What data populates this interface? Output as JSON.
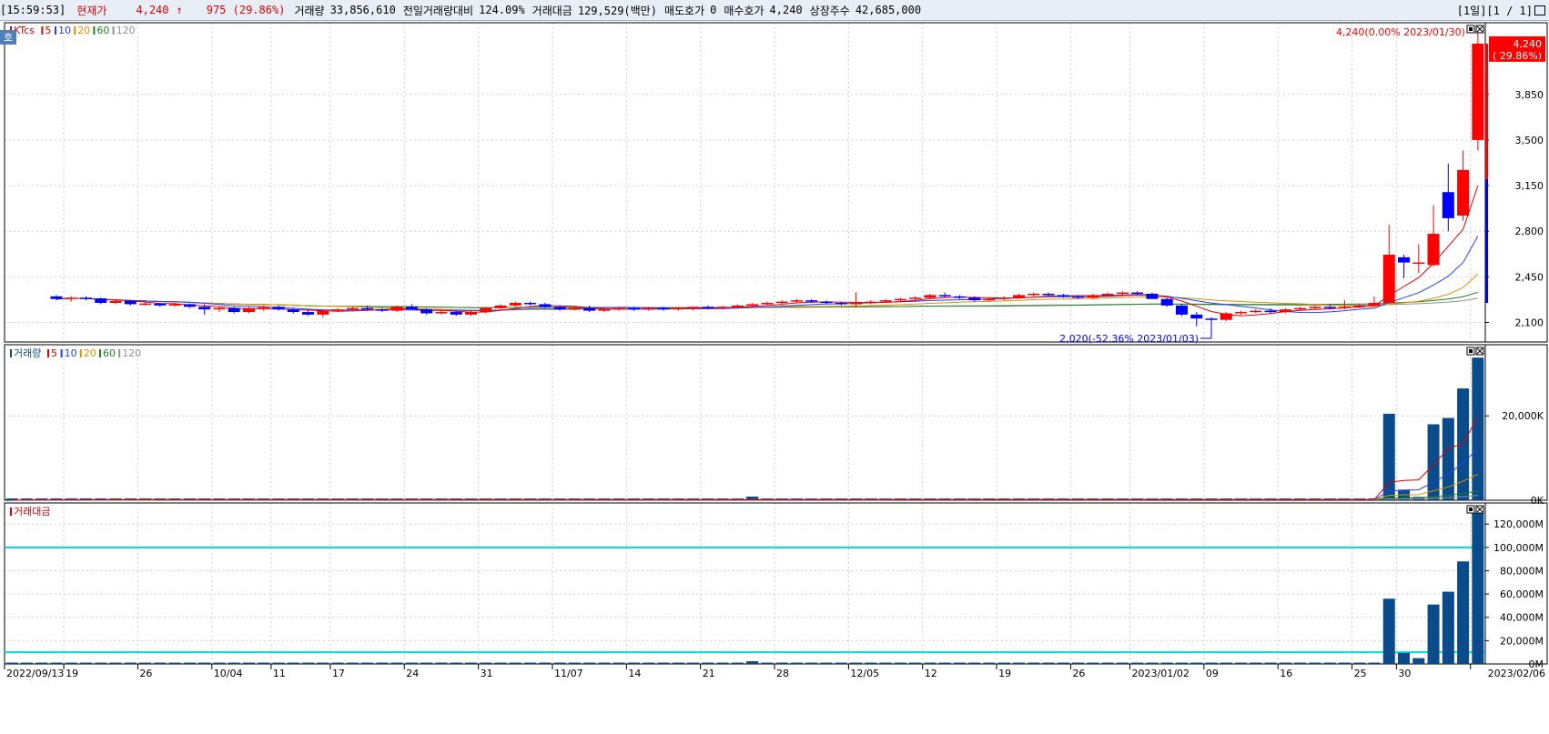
{
  "header": {
    "time": "[15:59:53]",
    "price_label": "현재가",
    "price": "4,240",
    "arrow": "↑",
    "change": "975 (29.86%)",
    "volume_label": "거래량",
    "volume": "33,856,610",
    "prev_ratio_label": "전일거래량대비",
    "prev_ratio": "124.09%",
    "amount_label": "거래대금",
    "amount": "129,529(백만)",
    "ask_label": "매도호가",
    "ask": "0",
    "bid_label": "매수호가",
    "bid": "4,240",
    "shares_label": "상장주수",
    "shares": "42,685,000",
    "period": "[1일][1 / 1]"
  },
  "colors": {
    "up": "#ff0000",
    "down": "#0000ff",
    "vol": "#0a4b8c",
    "ma5": "#e00000",
    "ma10": "#2040ff",
    "ma20": "#e09000",
    "ma60": "#208020",
    "ma120": "#909090",
    "ref": "#00d8e0"
  },
  "icons": {
    "panel_min": "minimize-icon",
    "panel_close": "close-icon",
    "side_tab": "ho-tab-icon"
  },
  "price_panel": {
    "side_tab": "호",
    "legend": [
      {
        "text": "KTcs",
        "color": "#e00000"
      },
      {
        "text": "5",
        "color": "#e00000"
      },
      {
        "text": "10",
        "color": "#2040ff"
      },
      {
        "text": "20",
        "color": "#e09000"
      },
      {
        "text": "60",
        "color": "#208020"
      },
      {
        "text": "120",
        "color": "#909090"
      }
    ],
    "high_annotation": "4,240(0.00% 2023/01/30)",
    "low_annotation": "2,020(-52.36% 2023/01/03)",
    "current_tag": "4,240",
    "current_tag_pct": "( 29.86%)"
  },
  "volume_panel": {
    "legend": [
      {
        "text": "거래량",
        "color": "#0a4b8c"
      },
      {
        "text": "5",
        "color": "#e00000"
      },
      {
        "text": "10",
        "color": "#2040ff"
      },
      {
        "text": "20",
        "color": "#e09000"
      },
      {
        "text": "60",
        "color": "#208020"
      },
      {
        "text": "120",
        "color": "#909090"
      }
    ]
  },
  "amount_panel": {
    "legend": [
      {
        "text": "거래대금",
        "color": "#e00000"
      }
    ]
  },
  "chart_data": [
    {
      "type": "candlestick",
      "name": "price",
      "ylim": [
        1950,
        4400
      ],
      "yticks": [
        2100,
        2450,
        2800,
        3150,
        3500,
        3850
      ],
      "ytick_labels": [
        "2,100",
        "2,450",
        "2,800",
        "3,150",
        "3,500",
        "3,850"
      ],
      "candles_approx": [
        [
          2300,
          2310,
          2270,
          2280
        ],
        [
          2280,
          2300,
          2260,
          2290
        ],
        [
          2290,
          2300,
          2270,
          2285
        ],
        [
          2285,
          2290,
          2240,
          2250
        ],
        [
          2250,
          2280,
          2240,
          2265
        ],
        [
          2265,
          2270,
          2230,
          2240
        ],
        [
          2240,
          2260,
          2230,
          2245
        ],
        [
          2245,
          2250,
          2220,
          2230
        ],
        [
          2230,
          2250,
          2220,
          2240
        ],
        [
          2240,
          2245,
          2210,
          2220
        ],
        [
          2220,
          2240,
          2160,
          2200
        ],
        [
          2200,
          2220,
          2180,
          2210
        ],
        [
          2210,
          2220,
          2170,
          2180
        ],
        [
          2180,
          2220,
          2170,
          2210
        ],
        [
          2210,
          2230,
          2190,
          2220
        ],
        [
          2220,
          2230,
          2190,
          2200
        ],
        [
          2200,
          2210,
          2170,
          2180
        ],
        [
          2180,
          2190,
          2150,
          2160
        ],
        [
          2160,
          2200,
          2140,
          2190
        ],
        [
          2190,
          2210,
          2180,
          2200
        ],
        [
          2200,
          2220,
          2190,
          2210
        ],
        [
          2210,
          2230,
          2190,
          2200
        ],
        [
          2200,
          2210,
          2180,
          2190
        ],
        [
          2190,
          2230,
          2180,
          2220
        ],
        [
          2220,
          2240,
          2210,
          2200
        ],
        [
          2200,
          2210,
          2160,
          2170
        ],
        [
          2170,
          2200,
          2160,
          2180
        ],
        [
          2180,
          2190,
          2150,
          2160
        ],
        [
          2160,
          2190,
          2150,
          2180
        ],
        [
          2180,
          2220,
          2170,
          2210
        ],
        [
          2210,
          2240,
          2200,
          2230
        ],
        [
          2230,
          2260,
          2220,
          2250
        ],
        [
          2250,
          2260,
          2230,
          2240
        ],
        [
          2240,
          2250,
          2210,
          2220
        ],
        [
          2220,
          2230,
          2190,
          2200
        ],
        [
          2200,
          2220,
          2190,
          2210
        ],
        [
          2210,
          2230,
          2180,
          2190
        ],
        [
          2190,
          2210,
          2180,
          2200
        ],
        [
          2200,
          2220,
          2190,
          2210
        ],
        [
          2210,
          2220,
          2190,
          2200
        ],
        [
          2200,
          2220,
          2190,
          2210
        ],
        [
          2210,
          2220,
          2190,
          2200
        ],
        [
          2200,
          2220,
          2190,
          2210
        ],
        [
          2210,
          2220,
          2190,
          2220
        ],
        [
          2220,
          2230,
          2200,
          2210
        ],
        [
          2210,
          2230,
          2200,
          2220
        ],
        [
          2220,
          2240,
          2210,
          2230
        ],
        [
          2230,
          2250,
          2220,
          2240
        ],
        [
          2240,
          2260,
          2230,
          2250
        ],
        [
          2250,
          2270,
          2240,
          2260
        ],
        [
          2260,
          2280,
          2250,
          2270
        ],
        [
          2270,
          2280,
          2250,
          2260
        ],
        [
          2260,
          2270,
          2240,
          2250
        ],
        [
          2250,
          2260,
          2230,
          2240
        ],
        [
          2240,
          2330,
          2220,
          2250
        ],
        [
          2250,
          2270,
          2240,
          2260
        ],
        [
          2260,
          2280,
          2250,
          2270
        ],
        [
          2270,
          2290,
          2260,
          2280
        ],
        [
          2280,
          2300,
          2270,
          2290
        ],
        [
          2290,
          2320,
          2280,
          2310
        ],
        [
          2310,
          2330,
          2290,
          2300
        ],
        [
          2300,
          2310,
          2280,
          2290
        ],
        [
          2290,
          2300,
          2260,
          2270
        ],
        [
          2270,
          2290,
          2260,
          2280
        ],
        [
          2280,
          2300,
          2270,
          2290
        ],
        [
          2290,
          2320,
          2280,
          2310
        ],
        [
          2310,
          2330,
          2300,
          2320
        ],
        [
          2320,
          2330,
          2300,
          2310
        ],
        [
          2310,
          2320,
          2290,
          2300
        ],
        [
          2300,
          2310,
          2280,
          2290
        ],
        [
          2290,
          2320,
          2280,
          2310
        ],
        [
          2310,
          2330,
          2300,
          2320
        ],
        [
          2320,
          2340,
          2310,
          2330
        ],
        [
          2330,
          2340,
          2310,
          2320
        ],
        [
          2320,
          2330,
          2290,
          2280
        ],
        [
          2280,
          2290,
          2220,
          2230
        ],
        [
          2230,
          2240,
          2150,
          2160
        ],
        [
          2160,
          2180,
          2070,
          2130
        ],
        [
          2130,
          2140,
          2020,
          2120
        ],
        [
          2120,
          2180,
          2110,
          2170
        ],
        [
          2170,
          2190,
          2160,
          2180
        ],
        [
          2180,
          2200,
          2170,
          2190
        ],
        [
          2190,
          2210,
          2170,
          2180
        ],
        [
          2180,
          2210,
          2170,
          2200
        ],
        [
          2200,
          2220,
          2190,
          2210
        ],
        [
          2210,
          2230,
          2200,
          2220
        ],
        [
          2220,
          2240,
          2200,
          2210
        ],
        [
          2210,
          2270,
          2200,
          2220
        ],
        [
          2220,
          2240,
          2210,
          2230
        ],
        [
          2230,
          2300,
          2220,
          2250
        ],
        [
          2250,
          2850,
          2250,
          2620
        ],
        [
          2600,
          2620,
          2440,
          2560
        ],
        [
          2550,
          2700,
          2480,
          2560
        ],
        [
          2540,
          3000,
          2530,
          2780
        ],
        [
          3100,
          3320,
          2800,
          2900
        ],
        [
          2920,
          3420,
          2880,
          3270
        ],
        [
          3500,
          4260,
          3420,
          4240
        ]
      ]
    },
    {
      "type": "bar",
      "name": "volume",
      "yticks": [
        0,
        20000
      ],
      "ytick_labels": [
        "0K",
        "20,000K"
      ],
      "ylim": [
        0,
        36000
      ],
      "values_approx_K": [
        20500,
        2500,
        800,
        18000,
        19500,
        26500,
        33800
      ]
    },
    {
      "type": "bar",
      "name": "trading_amount",
      "yticks": [
        0,
        20000,
        40000,
        60000,
        80000,
        100000,
        120000
      ],
      "ytick_labels": [
        "0M",
        "20,000M",
        "40,000M",
        "60,000M",
        "80,000M",
        "100,000M",
        "120,000M"
      ],
      "ylim": [
        0,
        135000
      ],
      "reference_lines": [
        100000,
        10000
      ],
      "values_approx_M": [
        56000,
        9500,
        5000,
        51000,
        62000,
        88000,
        129529
      ]
    }
  ],
  "x_axis": {
    "labels": [
      {
        "text": "2022/09/13",
        "pos": 0
      },
      {
        "text": "19",
        "pos": 4
      },
      {
        "text": "26",
        "pos": 9
      },
      {
        "text": "10/04",
        "pos": 14
      },
      {
        "text": "11",
        "pos": 18
      },
      {
        "text": "17",
        "pos": 22
      },
      {
        "text": "24",
        "pos": 27
      },
      {
        "text": "31",
        "pos": 32
      },
      {
        "text": "11/07",
        "pos": 37
      },
      {
        "text": "14",
        "pos": 42
      },
      {
        "text": "21",
        "pos": 47
      },
      {
        "text": "28",
        "pos": 52
      },
      {
        "text": "12/05",
        "pos": 57
      },
      {
        "text": "12",
        "pos": 62
      },
      {
        "text": "19",
        "pos": 67
      },
      {
        "text": "26",
        "pos": 72
      },
      {
        "text": "2023/01/02",
        "pos": 76
      },
      {
        "text": "09",
        "pos": 81
      },
      {
        "text": "16",
        "pos": 86
      },
      {
        "text": "25",
        "pos": 91
      },
      {
        "text": "30",
        "pos": 94
      },
      {
        "text": "2023/02/06",
        "pos": 99
      }
    ]
  }
}
